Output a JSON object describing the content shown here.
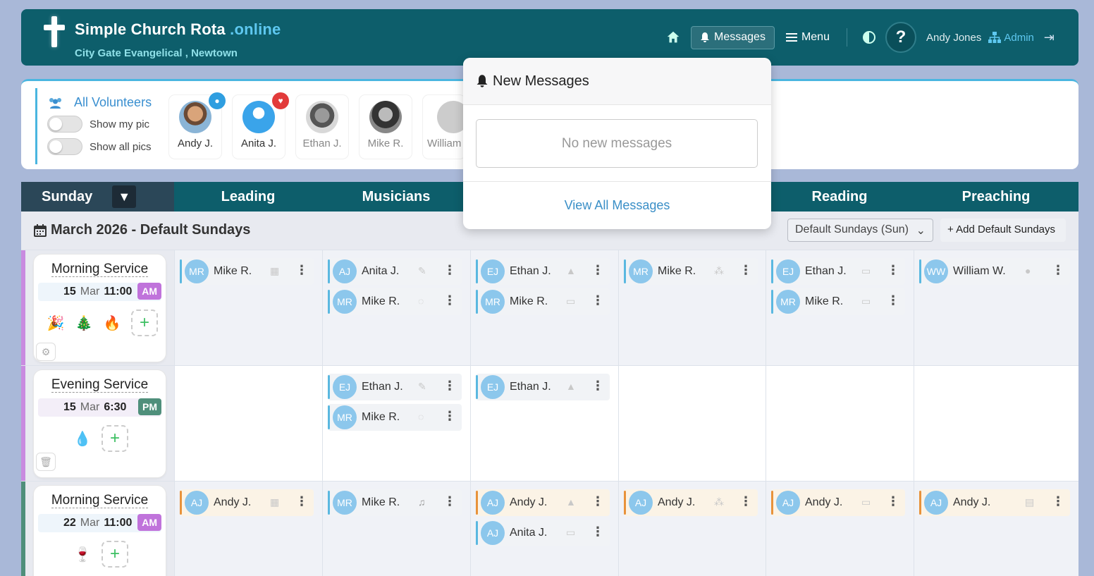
{
  "brand": {
    "title": "Simple Church Rota",
    "title_accent": ".online",
    "subtitle": "City Gate Evangelical , Newtown"
  },
  "nav": {
    "messages": "Messages",
    "menu": "Menu",
    "help": "?",
    "user": "Andy Jones",
    "admin": "Admin"
  },
  "volunteers": {
    "title": "All Volunteers",
    "show_my_pic": "Show my pic",
    "show_all_pics": "Show all pics",
    "people": [
      {
        "name": "Andy J.",
        "badge": "person-icon",
        "badge_color": "#2f9ee0"
      },
      {
        "name": "Anita J.",
        "badge": "heart-icon",
        "badge_color": "#e23b3b"
      },
      {
        "name": "Ethan J."
      },
      {
        "name": "Mike R."
      },
      {
        "name": "William"
      }
    ]
  },
  "columns": {
    "day": "Sunday",
    "leading": "Leading",
    "musicians": "Musicians",
    "reading": "Reading",
    "preaching": "Preaching"
  },
  "month": {
    "title": "March 2026 - Default Sundays",
    "select": "Default Sundays (Sun)",
    "add": "+ Add Default Sundays"
  },
  "services": [
    {
      "name": "Morning Service",
      "day": "15",
      "mon": "Mar",
      "time": "11:00",
      "ampm": "AM"
    },
    {
      "name": "Evening Service",
      "day": "15",
      "mon": "Mar",
      "time": "6:30",
      "ampm": "PM"
    },
    {
      "name": "Morning Service",
      "day": "22",
      "mon": "Mar",
      "time": "11:00",
      "ampm": "AM"
    }
  ],
  "chips": {
    "r1_lead": {
      "ini": "MR",
      "name": "Mike R."
    },
    "r1_mus1": {
      "ini": "AJ",
      "name": "Anita J."
    },
    "r1_mus2": {
      "ini": "MR",
      "name": "Mike R."
    },
    "r1_c3a": {
      "ini": "EJ",
      "name": "Ethan J."
    },
    "r1_c3b": {
      "ini": "MR",
      "name": "Mike R."
    },
    "r1_c4": {
      "ini": "MR",
      "name": "Mike R."
    },
    "r1_read1": {
      "ini": "EJ",
      "name": "Ethan J."
    },
    "r1_read2": {
      "ini": "MR",
      "name": "Mike R."
    },
    "r1_preach": {
      "ini": "WW",
      "name": "William W."
    },
    "r2_mus1": {
      "ini": "EJ",
      "name": "Ethan J."
    },
    "r2_mus2": {
      "ini": "MR",
      "name": "Mike R."
    },
    "r2_c3": {
      "ini": "EJ",
      "name": "Ethan J."
    },
    "r3_lead": {
      "ini": "AJ",
      "name": "Andy J."
    },
    "r3_mus": {
      "ini": "MR",
      "name": "Mike R."
    },
    "r3_c3a": {
      "ini": "AJ",
      "name": "Andy J."
    },
    "r3_c3b": {
      "ini": "AJ",
      "name": "Anita J."
    },
    "r3_c4": {
      "ini": "AJ",
      "name": "Andy J."
    },
    "r3_read": {
      "ini": "AJ",
      "name": "Andy J."
    },
    "r3_preach": {
      "ini": "AJ",
      "name": "Andy J."
    }
  },
  "messages": {
    "title": "New Messages",
    "empty": "No new messages",
    "view_all": "View All Messages"
  }
}
